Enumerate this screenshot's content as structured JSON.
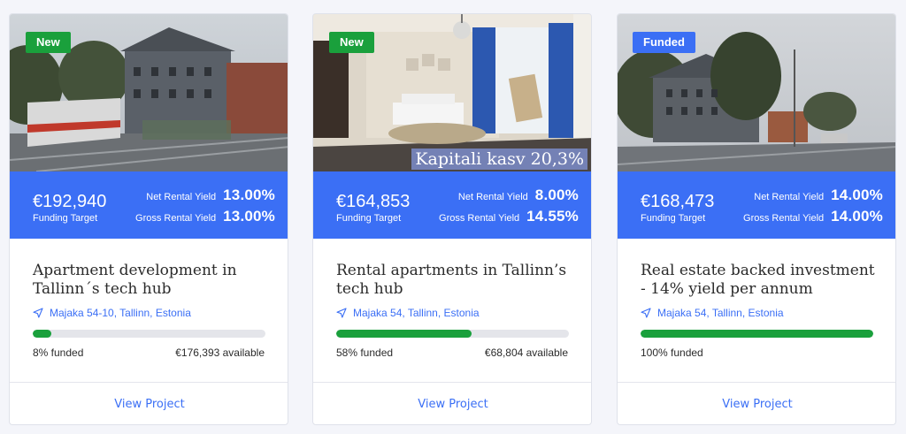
{
  "projects": [
    {
      "badge": "New",
      "amount": "€192,940",
      "amount_label": "Funding Target",
      "net_label": "Net Rental Yield",
      "net_value": "13.00%",
      "gross_label": "Gross Rental Yield",
      "gross_value": "13.00%",
      "title": "Apartment development in Tallinn´s tech hub",
      "location": "Majaka 54-10, Tallinn, Estonia",
      "progress_fraction": 0.08,
      "funded_text": "8% funded",
      "available_text": "€176,393 available",
      "button": "View Project"
    },
    {
      "badge": "New",
      "overlay": "Kapitali kasv 20,3%",
      "amount": "€164,853",
      "amount_label": "Funding Target",
      "net_label": "Net Rental Yield",
      "net_value": "8.00%",
      "gross_label": "Gross Rental Yield",
      "gross_value": "14.55%",
      "title": "Rental apartments in Tallinn’s tech hub",
      "location": "Majaka 54, Tallinn, Estonia",
      "progress_fraction": 0.58,
      "funded_text": "58% funded",
      "available_text": "€68,804 available",
      "button": "View Project"
    },
    {
      "badge": "Funded",
      "amount": "€168,473",
      "amount_label": "Funding Target",
      "net_label": "Net Rental Yield",
      "net_value": "14.00%",
      "gross_label": "Gross Rental Yield",
      "gross_value": "14.00%",
      "title": "Real estate backed investment - 14% yield per annum",
      "location": "Majaka 54, Tallinn, Estonia",
      "progress_fraction": 1.0,
      "funded_text": "100% funded",
      "available_text": "",
      "button": "View Project"
    }
  ],
  "colors": {
    "accent": "#3b6ff5",
    "badge_new": "#1aa03c",
    "badge_funded": "#3b6ff5",
    "progress": "#1aa03c",
    "progress_track": "#e4e5ea"
  },
  "icons": {
    "location": "location-arrow-icon"
  }
}
